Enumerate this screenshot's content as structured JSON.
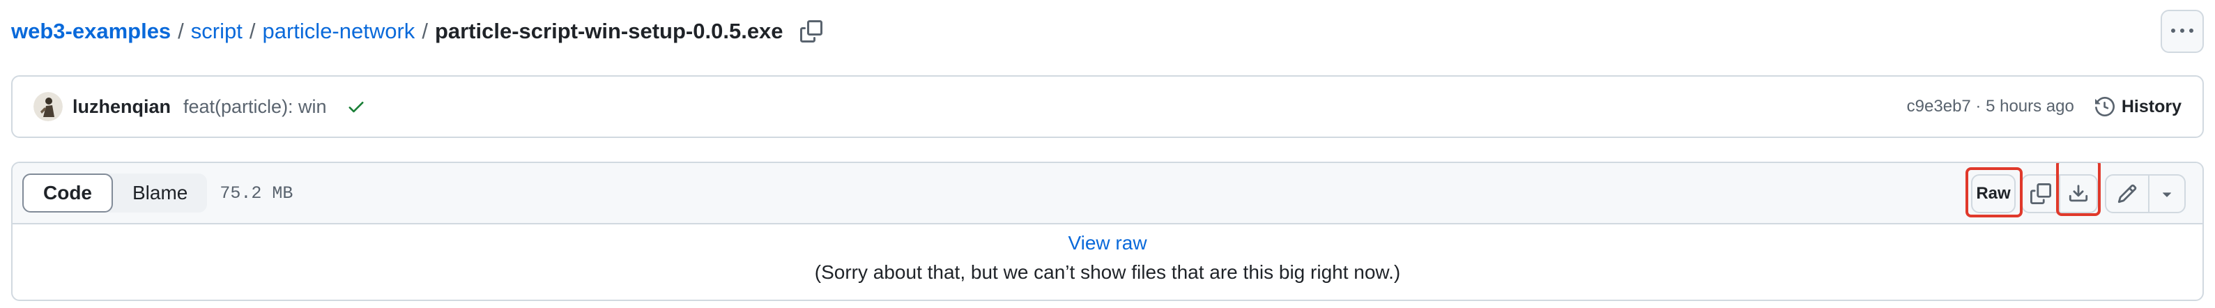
{
  "breadcrumb": {
    "repo": "web3-examples",
    "separator": "/",
    "folders": [
      "script",
      "particle-network"
    ],
    "file": "particle-script-win-setup-0.0.5.exe"
  },
  "icons": {
    "copy_path": "copy-icon",
    "more": "kebab-horizontal-icon",
    "check": "check-icon",
    "history": "history-icon",
    "copy": "copy-icon",
    "download": "download-icon",
    "edit": "pencil-icon",
    "dropdown": "triangle-down-icon"
  },
  "commit": {
    "author": "luzhenqian",
    "message": "feat(particle): win",
    "sha_time": "c9e3eb7 · 5 hours ago",
    "history_label": "History"
  },
  "file_header": {
    "tabs": [
      {
        "label": "Code",
        "active": true
      },
      {
        "label": "Blame",
        "active": false
      }
    ],
    "size": "75.2 MB",
    "raw_label": "Raw"
  },
  "file_body": {
    "view_raw": "View raw",
    "message": "(Sorry about that, but we can’t show files that are this big right now.)"
  },
  "colors": {
    "link": "#0969da",
    "border": "#d1d9e0",
    "header_bg": "#f6f8fa",
    "success": "#1a7f37",
    "highlight": "#e0392b"
  }
}
